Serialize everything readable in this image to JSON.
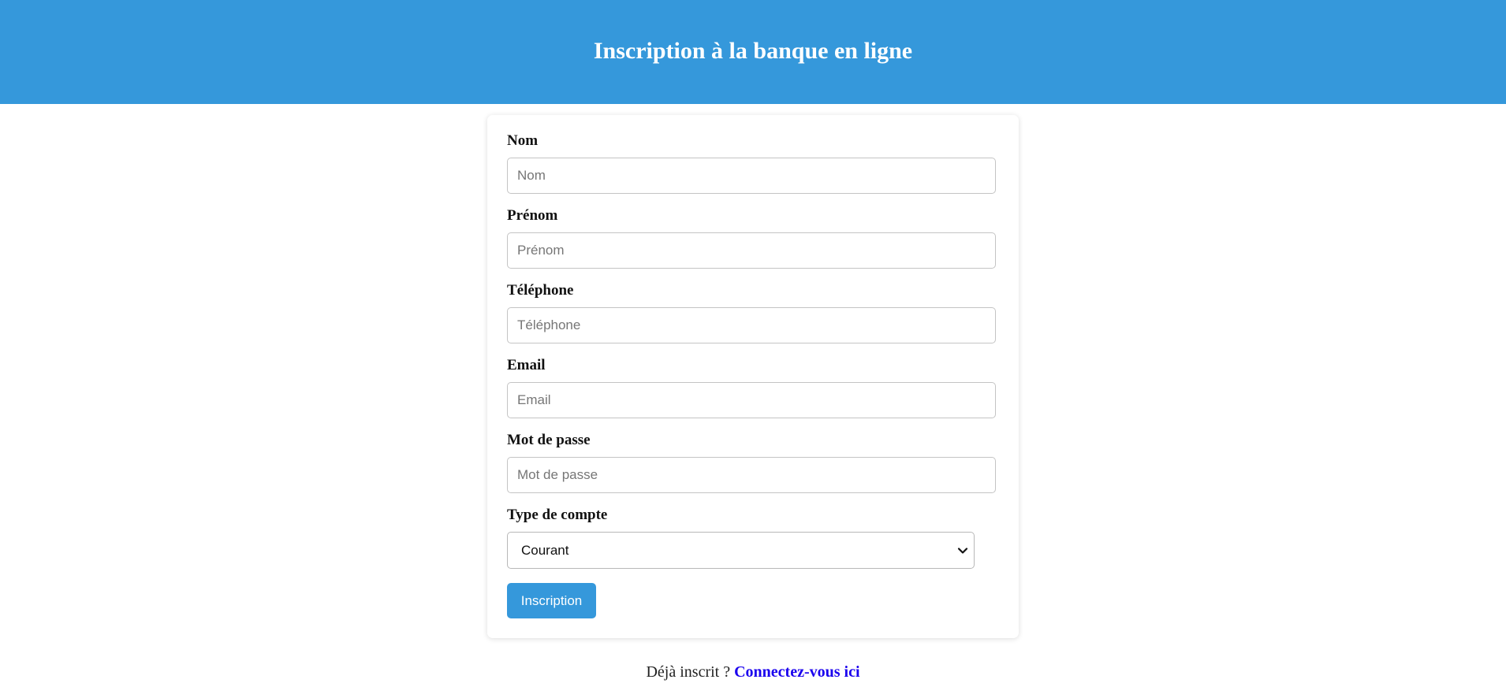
{
  "header": {
    "title": "Inscription à la banque en ligne"
  },
  "form": {
    "fields": [
      {
        "label": "Nom",
        "placeholder": "Nom",
        "value": ""
      },
      {
        "label": "Prénom",
        "placeholder": "Prénom",
        "value": ""
      },
      {
        "label": "Téléphone",
        "placeholder": "Téléphone",
        "value": ""
      },
      {
        "label": "Email",
        "placeholder": "Email",
        "value": ""
      },
      {
        "label": "Mot de passe",
        "placeholder": "Mot de passe",
        "value": ""
      }
    ],
    "account_type": {
      "label": "Type de compte",
      "selected": "Courant"
    },
    "submit_label": "Inscription"
  },
  "footer": {
    "prompt_text": "Déjà inscrit ?",
    "login_link": "Connectez-vous ici"
  },
  "colors": {
    "primary": "#3598db",
    "link": "#1a00ee"
  },
  "icons": {
    "select_arrow": "chevron-down-icon"
  }
}
